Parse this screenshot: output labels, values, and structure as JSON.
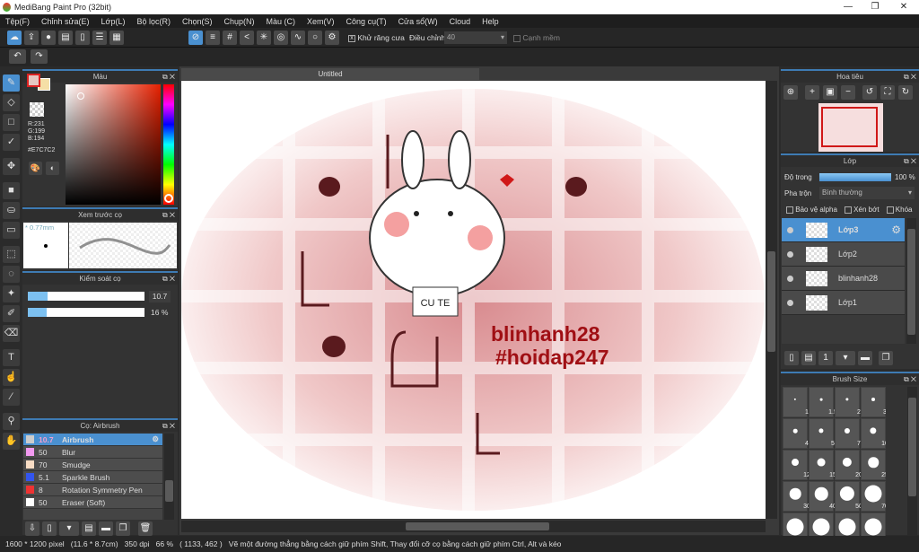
{
  "window": {
    "title": "MediBang Paint Pro (32bit)"
  },
  "menu": [
    "Tệp(F)",
    "Chỉnh sửa(E)",
    "Lớp(L)",
    "Bộ lọc(R)",
    "Chọn(S)",
    "Chụp(N)",
    "Màu (C)",
    "Xem(V)",
    "Công cụ(T)",
    "Cửa sổ(W)",
    "Cloud",
    "Help"
  ],
  "toolbar": {
    "antialias_label": "Khử răng cưa",
    "antialias_checked": true,
    "adjust_label": "Điều chỉnh",
    "adjust_value": "40",
    "soft_edge_label": "Cạnh mềm",
    "soft_edge_checked": false
  },
  "color_panel": {
    "title": "Màu",
    "r": "R:231",
    "g": "G:199",
    "b": "B:194",
    "hex": "#E7C7C2",
    "primary": "#E7C7C2",
    "secondary": "#F5DFA6"
  },
  "brush_preview": {
    "title": "Xem trước cọ",
    "size": "* 0.77mm"
  },
  "brush_control": {
    "title": "Kiểm soát cọ",
    "size_value": "10.7",
    "size_fraction": 0.17,
    "opacity_value": "16 %",
    "opacity_fraction": 0.16
  },
  "brush_list": {
    "title": "Cọ: Airbrush",
    "items": [
      {
        "size": "10.7",
        "name": "Airbrush",
        "color": "#cccccc",
        "selected": true
      },
      {
        "size": "50",
        "name": "Blur",
        "color": "#f29af0"
      },
      {
        "size": "70",
        "name": "Smudge",
        "color": "#f7dcc4"
      },
      {
        "size": "5.1",
        "name": "Sparkle Brush",
        "color": "#3355ee"
      },
      {
        "size": "8",
        "name": "Rotation Symmetry Pen",
        "color": "#ee3333"
      },
      {
        "size": "50",
        "name": "Eraser (Soft)",
        "color": "#ffffff"
      }
    ]
  },
  "document": {
    "tab": "Untitled",
    "artwork_text_1": "blinhanh28",
    "artwork_text_2": "#hoidap247",
    "badge_text": "CU TE"
  },
  "navigator": {
    "title": "Hoa tiêu"
  },
  "layers": {
    "title": "Lớp",
    "opacity_label": "Độ trong",
    "opacity_value": "100 %",
    "opacity_fraction": 1.0,
    "blend_label": "Pha trộn",
    "blend_value": "Bình thường",
    "protect_alpha": "Bảo vệ alpha",
    "clipping": "Xén bớt",
    "lock": "Khóa",
    "items": [
      {
        "name": "Lớp3",
        "selected": true
      },
      {
        "name": "Lớp2"
      },
      {
        "name": "blinhanh28"
      },
      {
        "name": "Lớp1"
      }
    ]
  },
  "brush_size": {
    "title": "Brush Size",
    "sizes": [
      "1",
      "1.5",
      "2",
      "3",
      "4",
      "5",
      "7",
      "10",
      "12",
      "15",
      "20",
      "25",
      "30",
      "40",
      "50",
      "70",
      "",
      "",
      "",
      ""
    ]
  },
  "status": {
    "dimensions": "1600 * 1200 pixel",
    "physical": "(11.6 * 8.7cm)",
    "dpi": "350 dpi",
    "zoom": "66 %",
    "coords": "( 1133, 462 )",
    "hint": "Vẽ một đường thẳng bằng cách giữ phím Shift, Thay đổi cỡ cọ bằng cách giữ phím Ctrl, Alt và kéo"
  }
}
